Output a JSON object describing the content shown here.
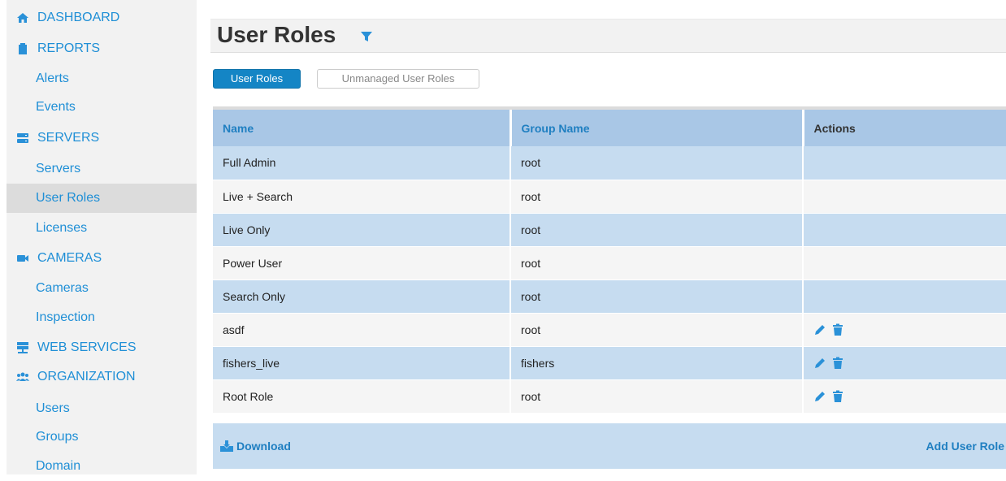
{
  "sidebar": {
    "items": [
      {
        "label": "DASHBOARD",
        "type": "section",
        "icon": "home-icon"
      },
      {
        "label": "REPORTS",
        "type": "section",
        "icon": "clipboard-icon"
      },
      {
        "label": "Alerts",
        "type": "sub"
      },
      {
        "label": "Events",
        "type": "sub"
      },
      {
        "label": "SERVERS",
        "type": "section",
        "icon": "server-icon"
      },
      {
        "label": "Servers",
        "type": "sub"
      },
      {
        "label": "User Roles",
        "type": "sub",
        "active": true
      },
      {
        "label": "Licenses",
        "type": "sub"
      },
      {
        "label": "CAMERAS",
        "type": "section",
        "icon": "video-camera-icon"
      },
      {
        "label": "Cameras",
        "type": "sub"
      },
      {
        "label": "Inspection",
        "type": "sub"
      },
      {
        "label": "WEB SERVICES",
        "type": "section",
        "icon": "network-icon"
      },
      {
        "label": "ORGANIZATION",
        "type": "section",
        "icon": "users-icon"
      },
      {
        "label": "Users",
        "type": "sub"
      },
      {
        "label": "Groups",
        "type": "sub"
      },
      {
        "label": "Domain",
        "type": "sub"
      }
    ]
  },
  "header": {
    "title": "User Roles",
    "filter_icon": "filter-icon"
  },
  "tabs": [
    {
      "label": "User Roles",
      "active": true
    },
    {
      "label": "Unmanaged User Roles",
      "active": false
    }
  ],
  "table": {
    "columns": [
      "Name",
      "Group Name",
      "Actions"
    ],
    "rows": [
      {
        "name": "Full Admin",
        "group": "root",
        "actions": false
      },
      {
        "name": "Live + Search",
        "group": "root",
        "actions": false
      },
      {
        "name": "Live Only",
        "group": "root",
        "actions": false
      },
      {
        "name": "Power User",
        "group": "root",
        "actions": false
      },
      {
        "name": "Search Only",
        "group": "root",
        "actions": false
      },
      {
        "name": "asdf",
        "group": "root",
        "actions": true
      },
      {
        "name": "fishers_live",
        "group": "fishers",
        "actions": true
      },
      {
        "name": "Root Role",
        "group": "root",
        "actions": true
      }
    ]
  },
  "footer": {
    "download_label": "Download",
    "add_label": "Add User Role"
  },
  "colors": {
    "accent": "#1f8fd6",
    "primary_tab": "#1485c5",
    "header_row": "#a9c7e6",
    "row_alt": "#c6dcf0"
  }
}
